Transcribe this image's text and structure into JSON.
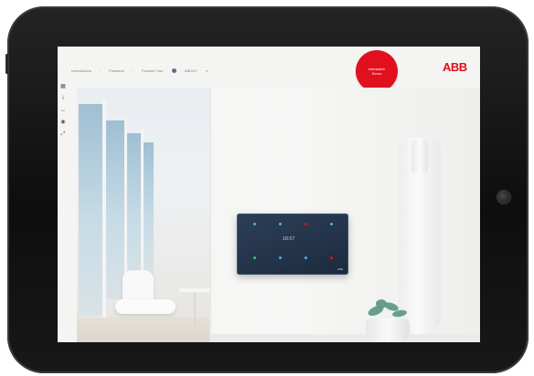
{
  "window": {
    "title": ""
  },
  "nav": {
    "items": [
      "Introduction",
      "Features",
      "Product Tour",
      "ABOUT"
    ]
  },
  "badge": {
    "line1": "Interactive",
    "line2": "Demo"
  },
  "brand": {
    "logo": "ABB",
    "color": "#e0101f"
  },
  "toolbar": {
    "items": [
      {
        "icon": "grid-icon",
        "glyph": "▦"
      },
      {
        "icon": "info-icon",
        "glyph": "i"
      },
      {
        "icon": "arrow-icon",
        "glyph": "↔"
      },
      {
        "icon": "camera-icon",
        "glyph": "◉"
      },
      {
        "icon": "zoom-icon",
        "glyph": "⤢"
      }
    ]
  },
  "device_panel": {
    "readout": "18:07",
    "logo": "ABB"
  },
  "colors": {
    "panel": "#233349",
    "accent_red": "#e0101f",
    "accent_cyan": "#4fb3e8",
    "accent_green": "#43c16b"
  }
}
